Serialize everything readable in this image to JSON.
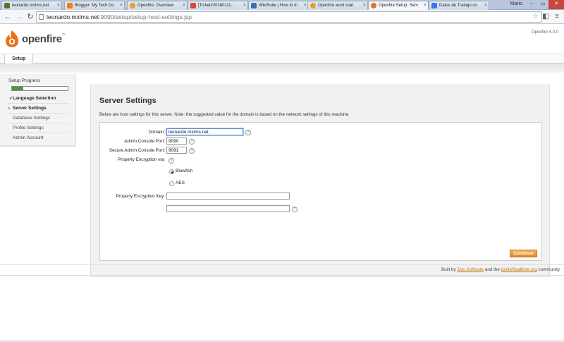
{
  "browser": {
    "tabs": [
      {
        "label": "leonardo.mxlms.net",
        "active": false,
        "favicon_color": "#4a7a2a"
      },
      {
        "label": "Blogger: My Tech Do",
        "active": false,
        "favicon_color": "#f57d00"
      },
      {
        "label": "Openfire: Overview",
        "active": false,
        "favicon_color": "#e6a02a"
      },
      {
        "label": "[Ticket#20160111…",
        "active": false,
        "favicon_color": "#d44638"
      },
      {
        "label": "WikiSuite | How to in",
        "active": false,
        "favicon_color": "#3a6fb0"
      },
      {
        "label": "Openfire wont start",
        "active": false,
        "favicon_color": "#e6a02a"
      },
      {
        "label": "Openfire Setup: Serv",
        "active": true,
        "favicon_color": "#e6731a"
      },
      {
        "label": "Datos de Trabajo co",
        "active": false,
        "favicon_color": "#3b78e7"
      }
    ],
    "user_label": "Mario",
    "url_host": "leonardo.mxlms.net",
    "url_rest": ":9090/setup/setup-host-settings.jsp"
  },
  "brand": {
    "name": "openfire",
    "tm": "™",
    "version": "Openfire 4.0.0"
  },
  "nav": {
    "tab": "Setup"
  },
  "sidebar": {
    "title": "Setup Progress",
    "progress": 0.2,
    "items": [
      {
        "label": "Language Selection",
        "state": "done",
        "mark": "✔"
      },
      {
        "label": "Server Settings",
        "state": "current",
        "mark": "▸"
      },
      {
        "label": "Database Settings",
        "state": "todo",
        "mark": ""
      },
      {
        "label": "Profile Settings",
        "state": "todo",
        "mark": ""
      },
      {
        "label": "Admin Account",
        "state": "todo",
        "mark": ""
      }
    ]
  },
  "main": {
    "title": "Server Settings",
    "description": "Below are host settings for this server. Note: the suggested value for the domain is based on the network settings of this machine.",
    "domain_label": "Domain:",
    "domain_value": "leonardo.mxlms.net",
    "admin_port_label": "Admin Console Port:",
    "admin_port_value": "9090",
    "secure_port_label": "Secure Admin Console Port:",
    "secure_port_value": "9091",
    "encryption_label": "Property Encryption via:",
    "enc_options": [
      "Blowfish",
      "AES"
    ],
    "enc_selected": "Blowfish",
    "key_label": "Property Encryption Key:",
    "key_value": "",
    "key_confirm_value": "",
    "help_glyph": "?",
    "continue_label": "Continue"
  },
  "footer": {
    "prefix": "Built by ",
    "link1": "Jive Software",
    "middle": " and the ",
    "link2": "IgniteRealtime.org",
    "suffix": " community"
  },
  "colors": {
    "accent": "#e08b1d",
    "progress": "#4a9a3a",
    "link": "#c87a10"
  }
}
